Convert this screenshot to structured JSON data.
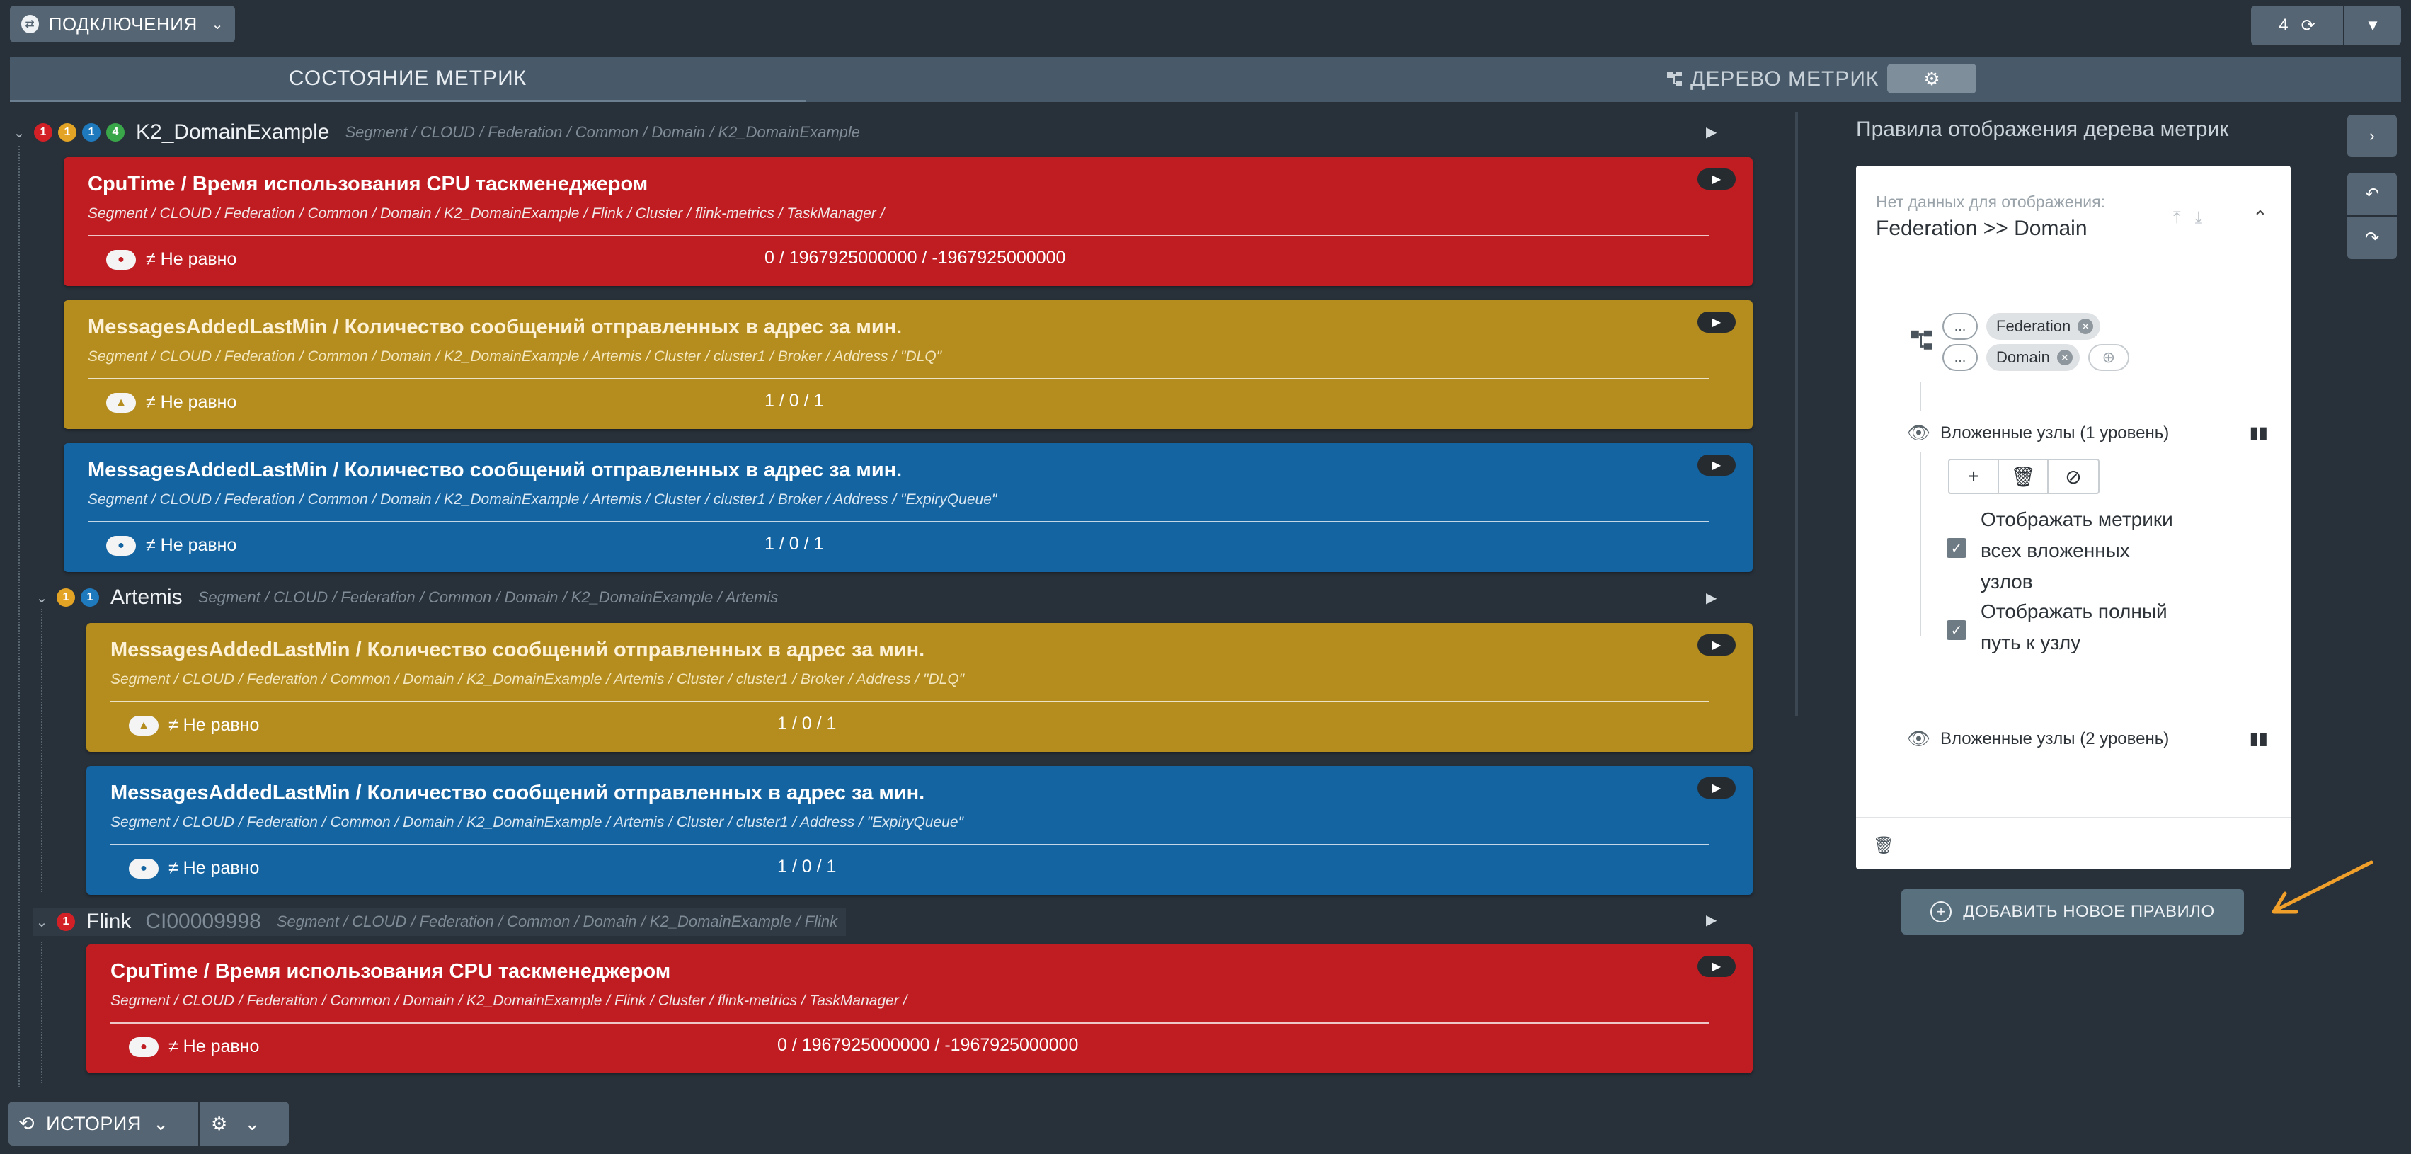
{
  "topbar": {
    "connections_label": "ПОДКЛЮЧЕНИЯ",
    "count": "4"
  },
  "tabs": {
    "state_label": "СОСТОЯНИЕ МЕТРИК",
    "tree_label": "ДЕРЕВО МЕТРИК"
  },
  "tree": {
    "root": {
      "title": "K2_DomainExample",
      "path": "Segment / CLOUD / Federation / Common / Domain / K2_DomainExample",
      "badges": [
        "1",
        "1",
        "1",
        "4"
      ]
    },
    "artemis": {
      "title": "Artemis",
      "path": "Segment / CLOUD / Federation / Common / Domain / K2_DomainExample / Artemis",
      "badges": [
        "1",
        "1"
      ]
    },
    "flink": {
      "title": "Flink",
      "id": "CI00009998",
      "path": "Segment / CLOUD / Federation / Common / Domain / K2_DomainExample / Flink",
      "badges": [
        "1"
      ]
    }
  },
  "cards": [
    {
      "title": "CpuTime / Время использования CPU таскменеджером",
      "path": "Segment / CLOUD / Federation / Common / Domain / K2_DomainExample / Flink / Cluster / flink-metrics / TaskManager /",
      "condition": "≠ Не равно",
      "value": "0 / 1967925000000 / -1967925000000"
    },
    {
      "title": "MessagesAddedLastMin / Количество сообщений отправленных в адрес за мин.",
      "path": "Segment / CLOUD / Federation / Common / Domain / K2_DomainExample / Artemis / Cluster / cluster1 / Broker  / Address / \"DLQ\"",
      "condition": "≠ Не равно",
      "value": "1 / 0 / 1"
    },
    {
      "title": "MessagesAddedLastMin / Количество сообщений отправленных в адрес за мин.",
      "path": "Segment / CLOUD / Federation / Common / Domain / K2_DomainExample / Artemis / Cluster / cluster1 / Broker  / Address / \"ExpiryQueue\"",
      "condition": "≠ Не равно",
      "value": "1 / 0 / 1"
    },
    {
      "title": "MessagesAddedLastMin / Количество сообщений отправленных в адрес за мин.",
      "path": "Segment / CLOUD / Federation / Common / Domain / K2_DomainExample / Artemis / Cluster / cluster1 / Broker  / Address / \"DLQ\"",
      "condition": "≠ Не равно",
      "value": "1 / 0 / 1"
    },
    {
      "title": "MessagesAddedLastMin / Количество сообщений отправленных в адрес за мин.",
      "path": "Segment / CLOUD / Federation / Common / Domain / K2_DomainExample / Artemis / Cluster / cluster1 / Address / \"ExpiryQueue\"",
      "condition": "≠ Не равно",
      "value": "1 / 0 / 1"
    },
    {
      "title": "CpuTime / Время использования CPU таскменеджером",
      "path": "Segment / CLOUD / Federation / Common / Domain / K2_DomainExample / Flink / Cluster / flink-metrics / TaskManager /",
      "condition": "≠ Не равно",
      "value": "0 / 1967925000000 / -1967925000000"
    }
  ],
  "right_panel": {
    "title": "Правила отображения дерева метрик",
    "rule": {
      "no_data_label": "Нет данных для отображения:",
      "heading": "Federation >> Domain",
      "dots": "...",
      "tags": [
        "Federation",
        "Domain"
      ],
      "level1_label": "Вложенные узлы (1 уровень)",
      "level2_label": "Вложенные узлы (2 уровень)",
      "checkbox1": "Отображать метрики всех вложенных узлов",
      "checkbox2": "Отображать полный путь к узлу"
    },
    "add_rule_label": "ДОБАВИТЬ НОВОЕ ПРАВИЛО"
  },
  "bottom": {
    "history_label": "ИСТОРИЯ"
  },
  "colors": {
    "card_red": "#c01d22",
    "card_yellow": "#b48d1e",
    "card_blue": "#1464a1",
    "arrow_orange": "#f0a02a"
  }
}
